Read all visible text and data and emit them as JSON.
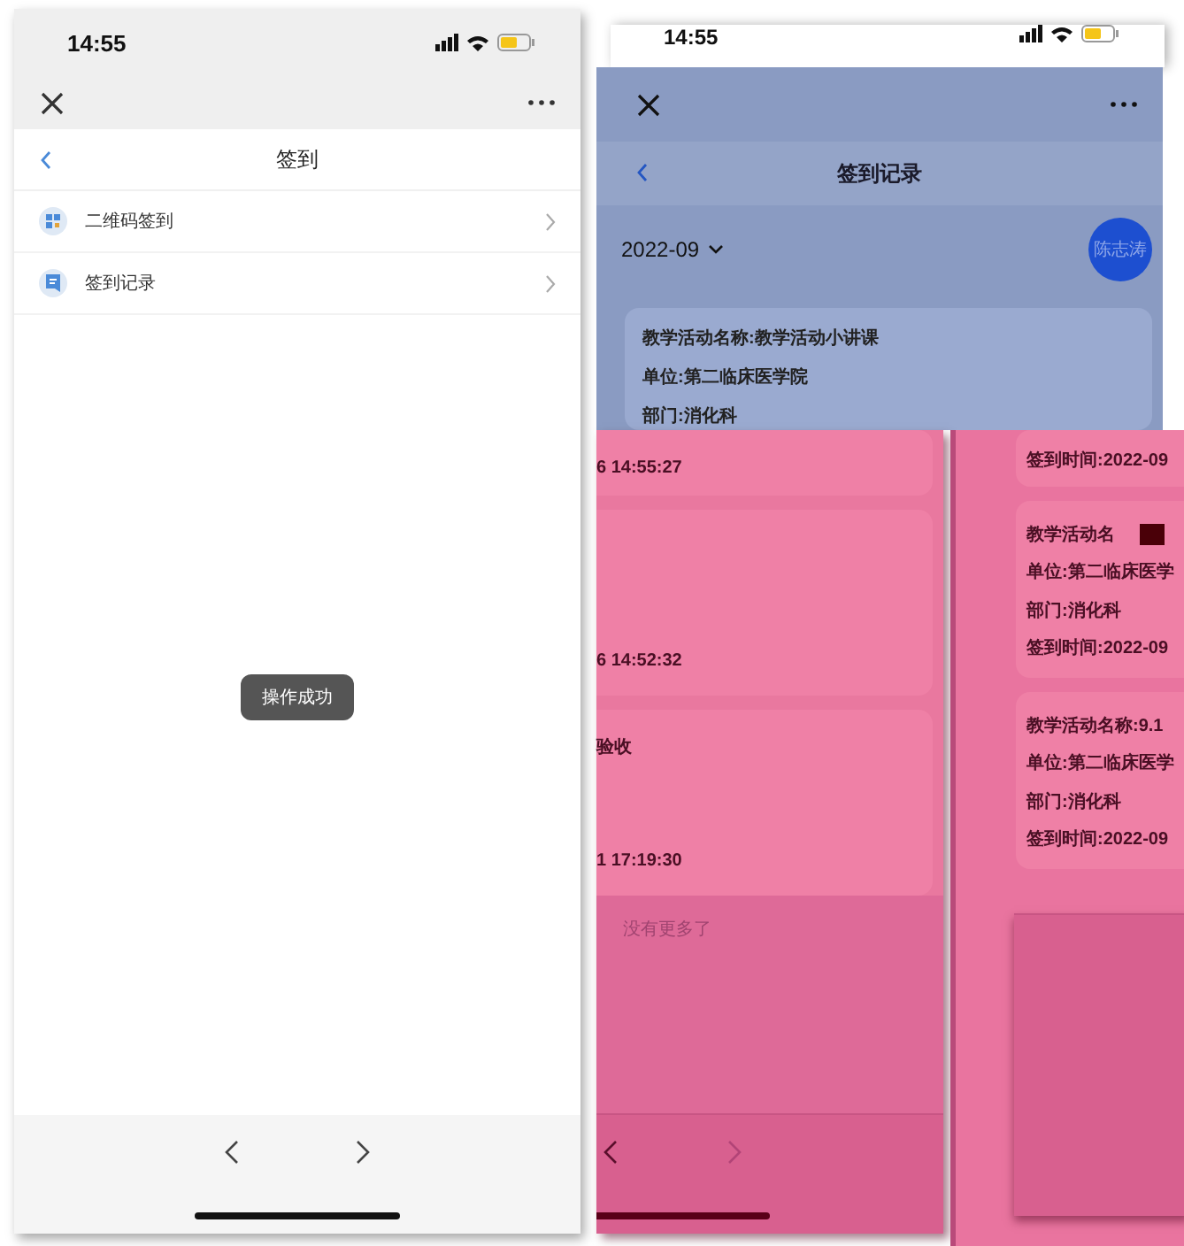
{
  "screens": [
    {
      "kind": "menu",
      "time": "14:55",
      "title": "签到",
      "items": [
        {
          "label": "二维码签到"
        },
        {
          "label": "签到记录"
        }
      ],
      "toast": "操作成功"
    },
    {
      "kind": "record-header",
      "time": "14:55",
      "title": "签到记录",
      "month": "2022-09",
      "avatar": "陈志涛",
      "card": [
        "教学活动名称:教学活动小讲课",
        "单位:第二临床医学院",
        "部门:消化科"
      ]
    },
    {
      "kind": "record-list-left",
      "cards": [
        {
          "lines": [
            "6 14:55:27"
          ]
        },
        {
          "lines": [
            "6 14:52:32"
          ]
        },
        {
          "lines": [
            "验收",
            "1 17:19:30"
          ]
        }
      ],
      "footer": "没有更多了"
    },
    {
      "kind": "record-list-right",
      "cards": [
        {
          "lines": [
            "签到时间:2022-09"
          ]
        },
        {
          "lines": [
            "教学活动名",
            "单位:第二临床医学",
            "部门:消化科",
            "签到时间:2022-09"
          ],
          "redacted": true
        },
        {
          "lines": [
            "教学活动名称:9.1",
            "单位:第二临床医学",
            "部门:消化科",
            "签到时间:2022-09"
          ]
        }
      ]
    }
  ]
}
